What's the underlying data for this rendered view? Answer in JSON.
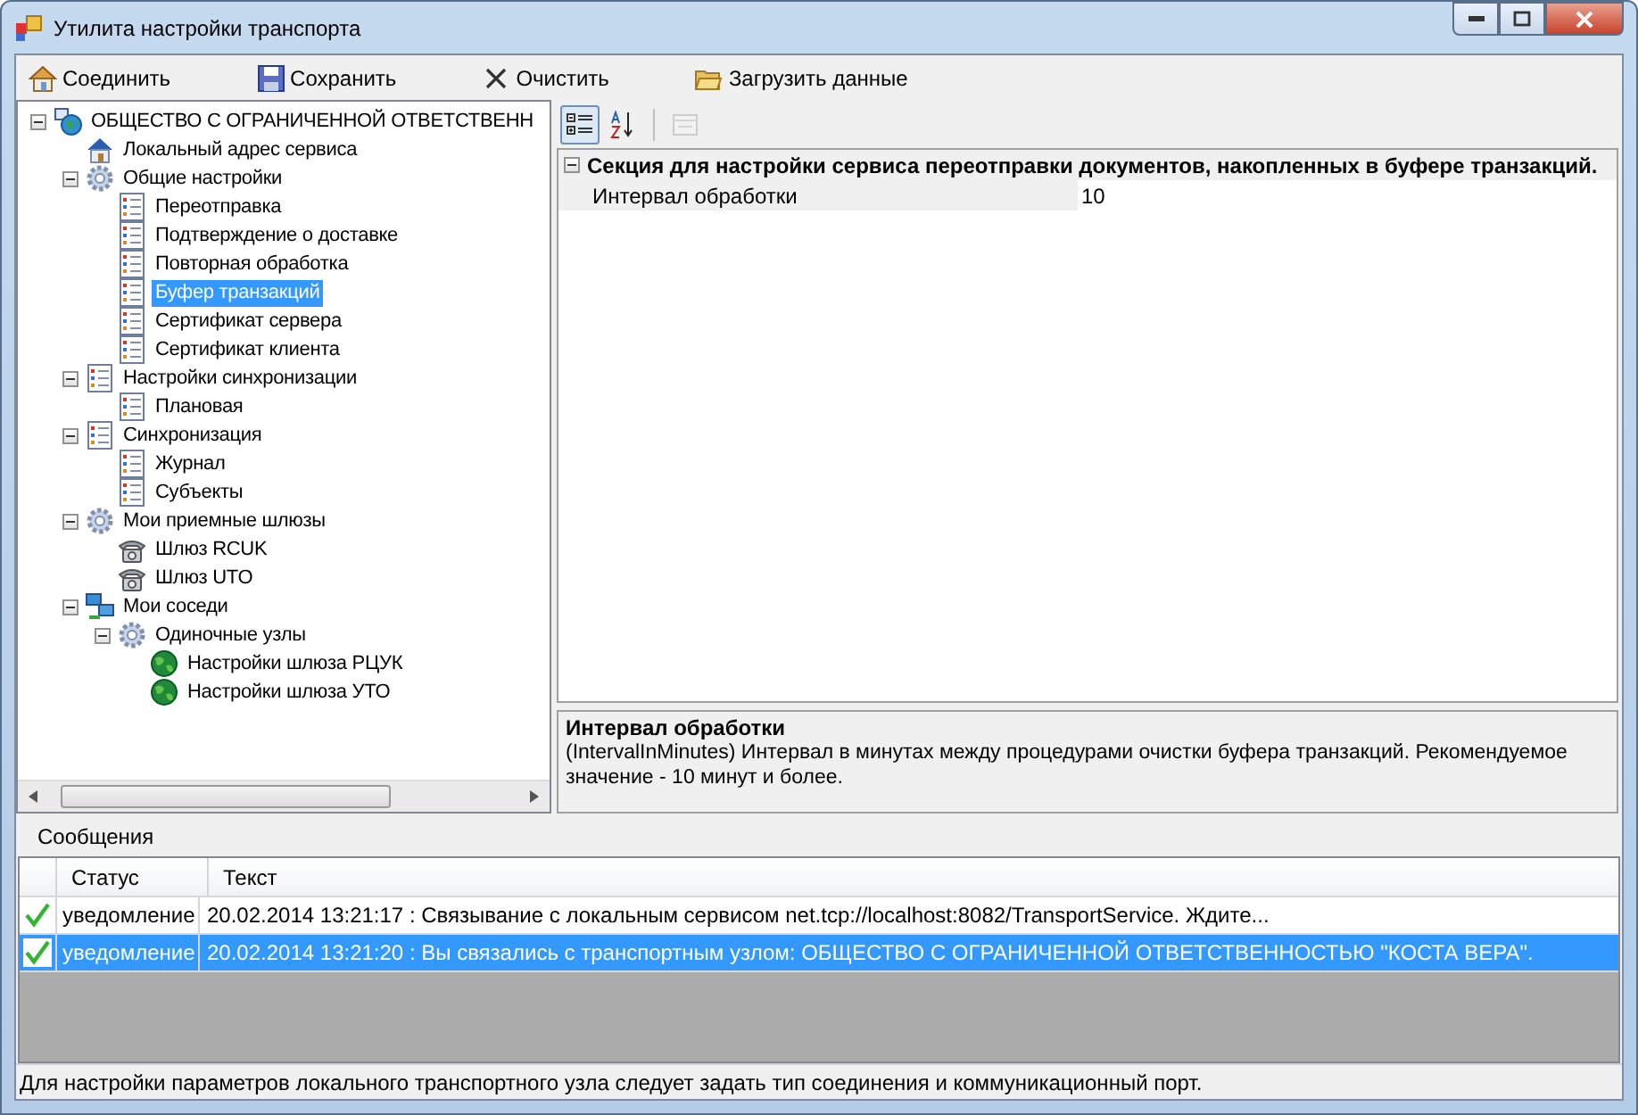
{
  "window": {
    "title": "Утилита настройки транспорта"
  },
  "toolbar": [
    {
      "kind": "connect",
      "label": "Соединить"
    },
    {
      "kind": "save",
      "label": "Сохранить"
    },
    {
      "kind": "clear",
      "label": "Очистить"
    },
    {
      "kind": "load",
      "label": "Загрузить данные"
    }
  ],
  "tree": [
    {
      "kind": "network-globe",
      "label": "ОБЩЕСТВО С ОГРАНИЧЕННОЙ ОТВЕТСТВЕНН",
      "expanded": true,
      "selected": false,
      "children": [
        {
          "kind": "house",
          "label": "Локальный адрес сервиса",
          "selected": false
        },
        {
          "kind": "gear",
          "label": "Общие настройки",
          "expanded": true,
          "selected": false,
          "children": [
            {
              "kind": "list",
              "label": "Переотправка",
              "selected": false
            },
            {
              "kind": "list",
              "label": "Подтверждение о доставке",
              "selected": false
            },
            {
              "kind": "list",
              "label": "Повторная обработка",
              "selected": false
            },
            {
              "kind": "list",
              "label": "Буфер транзакций",
              "selected": true
            },
            {
              "kind": "list",
              "label": "Сертификат сервера",
              "selected": false
            },
            {
              "kind": "list",
              "label": "Сертификат клиента",
              "selected": false
            }
          ]
        },
        {
          "kind": "list",
          "label": "Настройки синхронизации",
          "expanded": true,
          "selected": false,
          "children": [
            {
              "kind": "list",
              "label": "Плановая",
              "selected": false
            }
          ]
        },
        {
          "kind": "list",
          "label": "Синхронизация",
          "expanded": true,
          "selected": false,
          "children": [
            {
              "kind": "list",
              "label": "Журнал",
              "selected": false
            },
            {
              "kind": "list",
              "label": "Субъекты",
              "selected": false
            }
          ]
        },
        {
          "kind": "gear",
          "label": "Мои приемные шлюзы",
          "expanded": true,
          "selected": false,
          "children": [
            {
              "kind": "phone",
              "label": "Шлюз RCUK",
              "selected": false
            },
            {
              "kind": "phone",
              "label": "Шлюз UTO",
              "selected": false
            }
          ]
        },
        {
          "kind": "network",
          "label": "Мои соседи",
          "expanded": true,
          "selected": false,
          "children": [
            {
              "kind": "gear",
              "label": "Одиночные узлы",
              "expanded": true,
              "selected": false,
              "children": [
                {
                  "kind": "globe",
                  "label": "Настройки шлюза РЦУК",
                  "selected": false
                },
                {
                  "kind": "globe",
                  "label": "Настройки шлюза УТО",
                  "selected": false
                }
              ]
            }
          ]
        }
      ]
    }
  ],
  "property_grid": {
    "tools": [
      {
        "kind": "categorized",
        "selected": true,
        "disabled": false
      },
      {
        "kind": "alphabetical",
        "selected": false,
        "disabled": false
      },
      {
        "kind": "pages",
        "selected": false,
        "disabled": true
      }
    ],
    "section": {
      "title": "Секция для настройки сервиса переотправки документов, накопленных в буфере транзакций.",
      "expanded": true
    },
    "properties": [
      {
        "name": "Интервал обработки",
        "value": "10"
      }
    ],
    "description": {
      "title": "Интервал обработки",
      "text": "(IntervalInMinutes) Интервал в минутах между процедурами очистки буфера транзакций. Рекомендуемое значение - 10 минут и более."
    }
  },
  "messages": {
    "title": "Сообщения",
    "columns": [
      "Статус",
      "Текст"
    ],
    "rows": [
      {
        "status": "уведомление",
        "text": "20.02.2014 13:21:17 : Связывание с локальным сервисом net.tcp://localhost:8082/TransportService. Ждите...",
        "selected": false
      },
      {
        "status": "уведомление",
        "text": "20.02.2014 13:21:20 : Вы связались с транспортным узлом: ОБЩЕСТВО С ОГРАНИЧЕННОЙ ОТВЕТСТВЕННОСТЬЮ \"КОСТА ВЕРА\".",
        "selected": true
      }
    ]
  },
  "status_bar": {
    "text": "Для настройки параметров локального транспортного узла следует задать тип соединения и коммуникационный порт."
  }
}
